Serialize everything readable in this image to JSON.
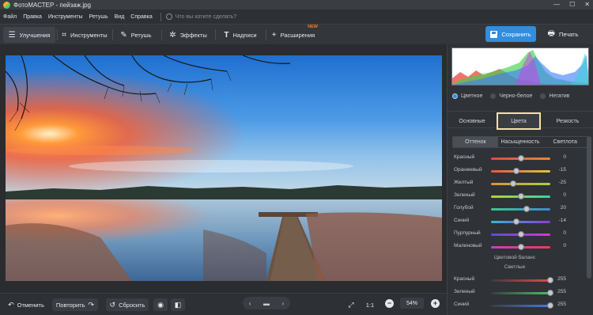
{
  "window": {
    "title": "ФотоМАСТЕР - пейзаж.jpg",
    "minimize": "—",
    "maximize": "☐",
    "close": "✕"
  },
  "menu": {
    "items": [
      "Файл",
      "Правка",
      "Инструменты",
      "Ретушь",
      "Вид",
      "Справка"
    ],
    "search_placeholder": "Что вы хотите сделать?"
  },
  "toolbar": {
    "tabs": [
      {
        "label": "Улучшения",
        "icon": "sliders-icon",
        "glyph": "☰",
        "active": true
      },
      {
        "label": "Инструменты",
        "icon": "crop-icon",
        "glyph": "⌗"
      },
      {
        "label": "Ретушь",
        "icon": "brush-icon",
        "glyph": "✎"
      },
      {
        "label": "Эффекты",
        "icon": "magic-wand-icon",
        "glyph": "✲"
      },
      {
        "label": "Надписи",
        "icon": "text-icon",
        "glyph": "T"
      },
      {
        "label": "Расширения",
        "icon": "plus-icon",
        "glyph": "+",
        "badge": "NEW"
      }
    ],
    "save_label": "Сохранить",
    "print_label": "Печать"
  },
  "bottom": {
    "undo_label": "Отменить",
    "redo_label": "Повторить",
    "reset_label": "Сбросить",
    "ratio_label": "1:1",
    "zoom": "54%"
  },
  "panel": {
    "modes": [
      {
        "label": "Цветное",
        "selected": true
      },
      {
        "label": "Черно-белое",
        "selected": false
      },
      {
        "label": "Негатив",
        "selected": false
      }
    ],
    "tabs": [
      "Основные",
      "Цвета",
      "Резкость"
    ],
    "active_tab": "Цвета",
    "subtabs": [
      "Оттенок",
      "Насыщенность",
      "Светлота"
    ],
    "active_subtab": "Оттенок",
    "sliders": [
      {
        "label": "Красный",
        "value": 0,
        "min": -100,
        "max": 100,
        "colors": [
          "#e04848",
          "#e08a3c"
        ]
      },
      {
        "label": "Оранжевый",
        "value": -15,
        "min": -100,
        "max": 100,
        "colors": [
          "#e05a3c",
          "#e0c23c"
        ]
      },
      {
        "label": "Желтый",
        "value": -25,
        "min": -100,
        "max": 100,
        "colors": [
          "#e0903c",
          "#a6d23c"
        ]
      },
      {
        "label": "Зеленый",
        "value": 0,
        "min": -100,
        "max": 100,
        "colors": [
          "#b7d23c",
          "#3cd2a0"
        ]
      },
      {
        "label": "Голубой",
        "value": 20,
        "min": -100,
        "max": 100,
        "colors": [
          "#3cc88c",
          "#3c8ad2"
        ]
      },
      {
        "label": "Синий",
        "value": -14,
        "min": -100,
        "max": 100,
        "colors": [
          "#3cb4d2",
          "#8a3cd2"
        ]
      },
      {
        "label": "Пурпурный",
        "value": 0,
        "min": -100,
        "max": 100,
        "colors": [
          "#5a4ae0",
          "#d23cc8"
        ]
      },
      {
        "label": "Малиновый",
        "value": 0,
        "min": -100,
        "max": 100,
        "colors": [
          "#c83cd2",
          "#e0405a"
        ]
      }
    ],
    "balance_title": "Цветовой баланс",
    "balance_sub": "Светлые",
    "balance": [
      {
        "label": "Красный",
        "value": 255,
        "min": 0,
        "max": 255,
        "colors": [
          "#3a3d42",
          "#e04848"
        ]
      },
      {
        "label": "Зеленый",
        "value": 255,
        "min": 0,
        "max": 255,
        "colors": [
          "#3a3d42",
          "#48c060"
        ]
      },
      {
        "label": "Синий",
        "value": 255,
        "min": 0,
        "max": 255,
        "colors": [
          "#3a3d42",
          "#4878e0"
        ]
      }
    ]
  },
  "colors": {
    "accent": "#2f8ee0",
    "highlight_border": "#f5e3a4",
    "badge": "#ff7a1a"
  }
}
